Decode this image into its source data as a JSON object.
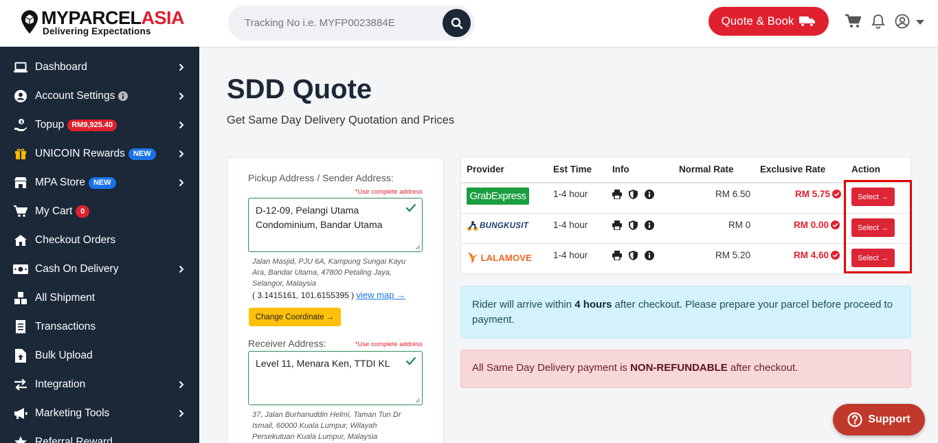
{
  "brand": {
    "name_part1": "MYPARCEL",
    "name_part2": "ASIA",
    "tagline": "Delivering Expectations"
  },
  "header": {
    "search_placeholder": "Tracking No i.e. MYFP0023884E",
    "quote_label": "Quote & Book"
  },
  "sidebar": {
    "items": [
      {
        "label": "Dashboard",
        "icon": "laptop-icon",
        "chevron": true
      },
      {
        "label": "Account Settings",
        "icon": "user-circle-icon",
        "chevron": true,
        "info": true
      },
      {
        "label": "Topup",
        "icon": "hand-coin-icon",
        "chevron": true,
        "badge": "RM9,925.40"
      },
      {
        "label": "UNICOIN Rewards",
        "icon": "gift-icon",
        "chevron": true,
        "badge": "NEW"
      },
      {
        "label": "MPA Store",
        "icon": "store-icon",
        "chevron": true,
        "badge": "NEW"
      },
      {
        "label": "My Cart",
        "icon": "cart-icon",
        "chevron": false,
        "badge": "0"
      },
      {
        "label": "Checkout Orders",
        "icon": "house-icon",
        "chevron": false
      },
      {
        "label": "Cash On Delivery",
        "icon": "cash-icon",
        "chevron": true
      },
      {
        "label": "All Shipment",
        "icon": "boxes-icon",
        "chevron": false
      },
      {
        "label": "Transactions",
        "icon": "receipt-icon",
        "chevron": false
      },
      {
        "label": "Bulk Upload",
        "icon": "file-upload-icon",
        "chevron": false
      },
      {
        "label": "Integration",
        "icon": "arrows-exchange-icon",
        "chevron": true
      },
      {
        "label": "Marketing Tools",
        "icon": "megaphone-icon",
        "chevron": true
      },
      {
        "label": "Referral Reward",
        "icon": "star-icon",
        "chevron": false
      }
    ]
  },
  "page": {
    "title": "SDD Quote",
    "subtitle": "Get Same Day Delivery Quotation and Prices"
  },
  "form": {
    "pickup_label": "Pickup Address / Sender Address:",
    "pickup_hint": "*Use complete address",
    "pickup_value": "D-12-09, Pelangi Utama Condominium, Bandar Utama",
    "pickup_detail": "Jalan Masjid, PJU 6A, Kampung Sungai Kayu Ara, Bandar Utama, 47800 Petaling Jaya, Selangor, Malaysia",
    "pickup_coord": "( 3.1415161, 101.6155395 )",
    "view_map": "view map →",
    "change_coord": "Change Coordinate →",
    "receiver_label": "Receiver Address:",
    "receiver_hint": "*Use complete address",
    "receiver_value": "Level 11, Menara Ken, TTDI KL",
    "receiver_detail": "37, Jalan Burhanuddin Helmi, Taman Tun Dr Ismail, 60000 Kuala Lumpur, Wilayah Persekutuan Kuala Lumpur, Malaysia"
  },
  "rates": {
    "headers": {
      "provider": "Provider",
      "est_time": "Est Time",
      "info": "Info",
      "normal": "Normal Rate",
      "exclusive": "Exclusive Rate",
      "action": "Action"
    },
    "rows": [
      {
        "provider": "GrabExpress",
        "est_time": "1-4 hour",
        "normal": "RM 6.50",
        "exclusive": "RM 5.75",
        "action": "Select →"
      },
      {
        "provider": "BUNGKUSIT",
        "est_time": "1-4 hour",
        "normal": "RM 0",
        "exclusive": "RM 0.00",
        "action": "Select →"
      },
      {
        "provider": "LALAMOVE",
        "est_time": "1-4 hour",
        "normal": "RM 5.20",
        "exclusive": "RM 4.60",
        "action": "Select →"
      }
    ]
  },
  "alerts": {
    "info_pre": "Rider will arrive within ",
    "info_bold": "4 hours",
    "info_post": " after checkout. Please prepare your parcel before proceed to payment.",
    "danger_pre": "All Same Day Delivery payment is ",
    "danger_bold": "NON-REFUNDABLE",
    "danger_post": " after checkout."
  },
  "support": {
    "label": "Support"
  },
  "colors": {
    "brand_red": "#e0202e",
    "sidebar_bg": "#1b2838",
    "badge_blue": "#1a73e8",
    "coord_btn": "#ffc107"
  }
}
